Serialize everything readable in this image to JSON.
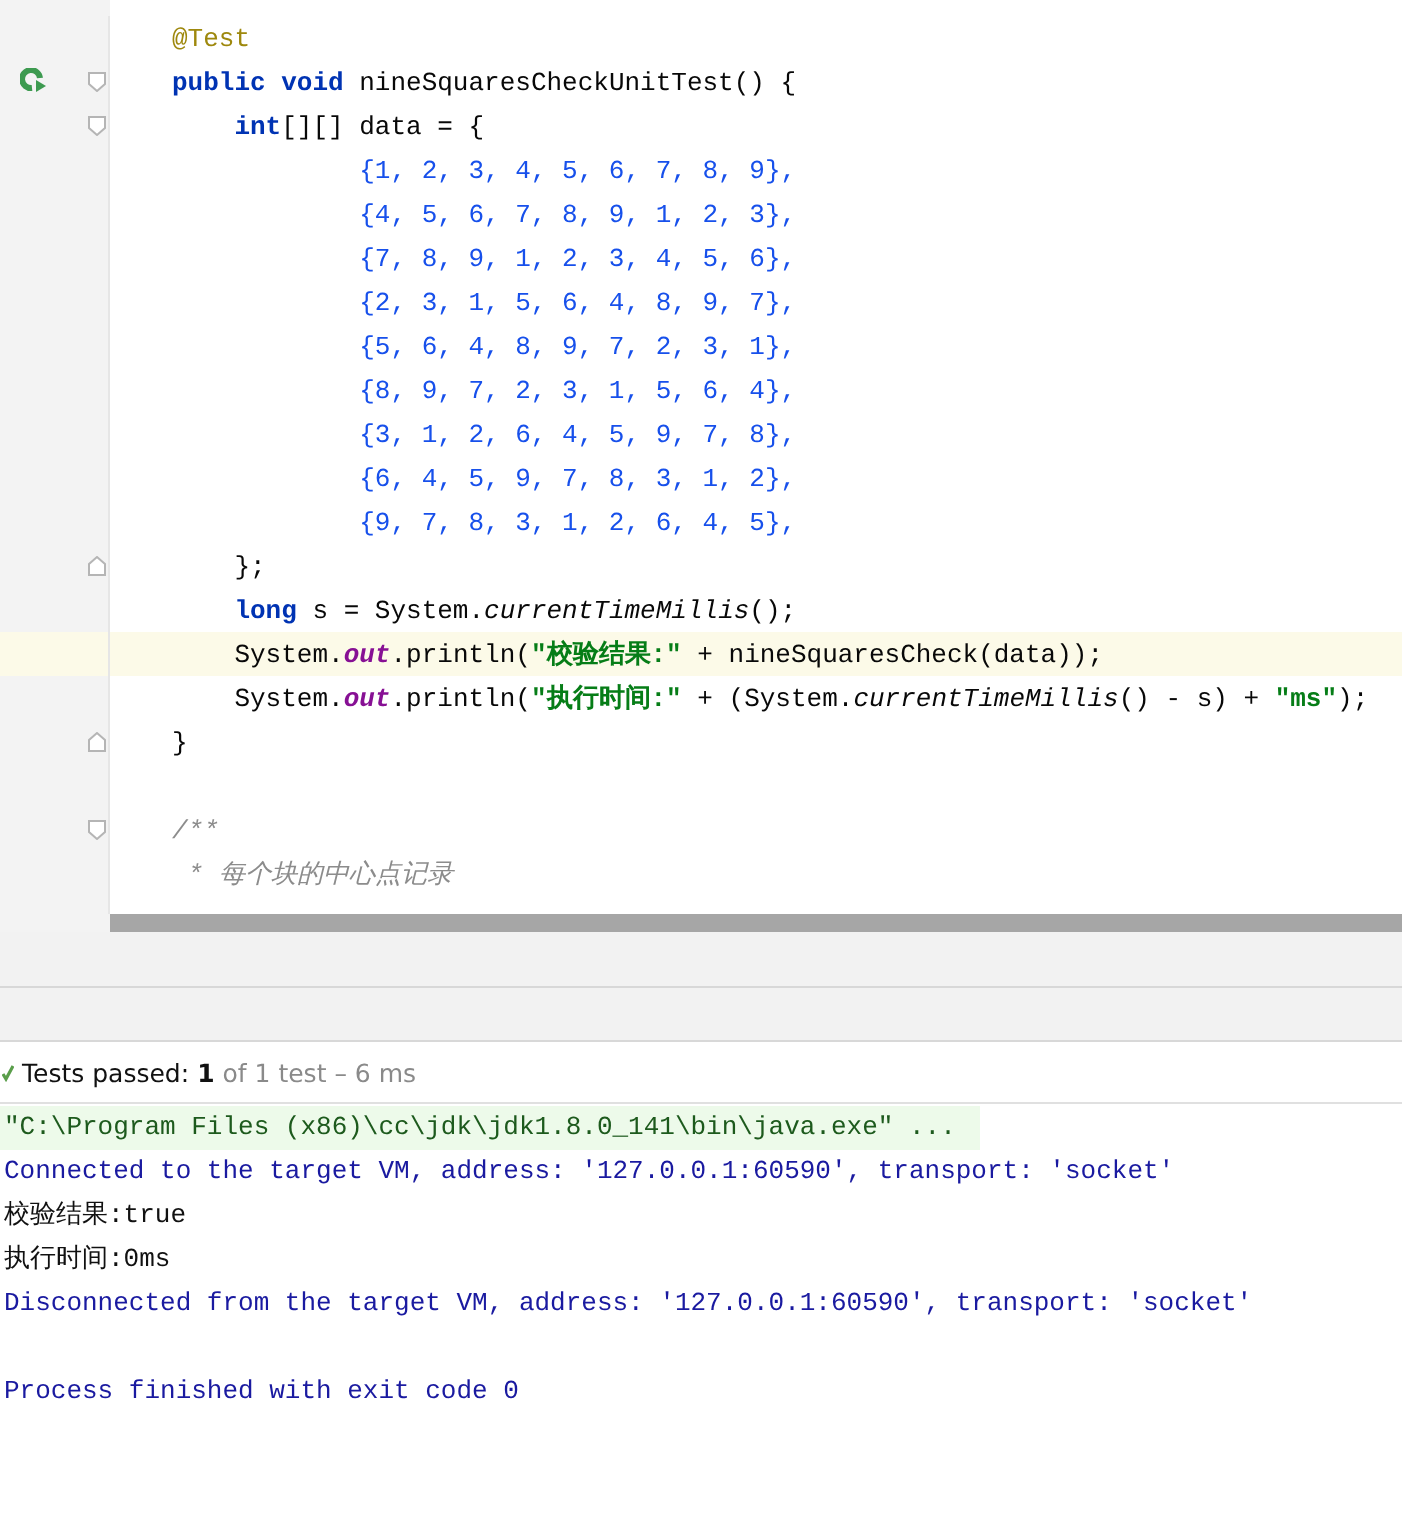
{
  "editor": {
    "lines": [
      {
        "highlighted": false,
        "runnable": false,
        "fold_open": false,
        "fold_close": false,
        "tokens": [
          {
            "text": "@Test",
            "kind": "annotation"
          }
        ]
      },
      {
        "highlighted": false,
        "runnable": true,
        "fold_open": true,
        "fold_close": false,
        "tokens": [
          {
            "text": "public void",
            "kind": "keyword"
          },
          {
            "text": " nineSquaresCheckUnitTest() {",
            "kind": "plain"
          }
        ]
      },
      {
        "highlighted": false,
        "runnable": false,
        "fold_open": true,
        "fold_close": false,
        "tokens": [
          {
            "text": "    int",
            "kind": "keyword"
          },
          {
            "text": "[][] data = {",
            "kind": "plain"
          }
        ]
      },
      {
        "highlighted": false,
        "runnable": false,
        "fold_open": false,
        "fold_close": false,
        "tokens": [
          {
            "text": "            {1, 2, 3, 4, 5, 6, 7, 8, 9},",
            "kind": "number"
          }
        ]
      },
      {
        "highlighted": false,
        "runnable": false,
        "fold_open": false,
        "fold_close": false,
        "tokens": [
          {
            "text": "            {4, 5, 6, 7, 8, 9, 1, 2, 3},",
            "kind": "number"
          }
        ]
      },
      {
        "highlighted": false,
        "runnable": false,
        "fold_open": false,
        "fold_close": false,
        "tokens": [
          {
            "text": "            {7, 8, 9, 1, 2, 3, 4, 5, 6},",
            "kind": "number"
          }
        ]
      },
      {
        "highlighted": false,
        "runnable": false,
        "fold_open": false,
        "fold_close": false,
        "tokens": [
          {
            "text": "            {2, 3, 1, 5, 6, 4, 8, 9, 7},",
            "kind": "number"
          }
        ]
      },
      {
        "highlighted": false,
        "runnable": false,
        "fold_open": false,
        "fold_close": false,
        "tokens": [
          {
            "text": "            {5, 6, 4, 8, 9, 7, 2, 3, 1},",
            "kind": "number"
          }
        ]
      },
      {
        "highlighted": false,
        "runnable": false,
        "fold_open": false,
        "fold_close": false,
        "tokens": [
          {
            "text": "            {8, 9, 7, 2, 3, 1, 5, 6, 4},",
            "kind": "number"
          }
        ]
      },
      {
        "highlighted": false,
        "runnable": false,
        "fold_open": false,
        "fold_close": false,
        "tokens": [
          {
            "text": "            {3, 1, 2, 6, 4, 5, 9, 7, 8},",
            "kind": "number"
          }
        ]
      },
      {
        "highlighted": false,
        "runnable": false,
        "fold_open": false,
        "fold_close": false,
        "tokens": [
          {
            "text": "            {6, 4, 5, 9, 7, 8, 3, 1, 2},",
            "kind": "number"
          }
        ]
      },
      {
        "highlighted": false,
        "runnable": false,
        "fold_open": false,
        "fold_close": false,
        "tokens": [
          {
            "text": "            {9, 7, 8, 3, 1, 2, 6, 4, 5},",
            "kind": "number"
          }
        ]
      },
      {
        "highlighted": false,
        "runnable": false,
        "fold_open": false,
        "fold_close": true,
        "tokens": [
          {
            "text": "    };",
            "kind": "plain"
          }
        ]
      },
      {
        "highlighted": false,
        "runnable": false,
        "fold_open": false,
        "fold_close": false,
        "tokens": [
          {
            "text": "    long",
            "kind": "keyword"
          },
          {
            "text": " s = System.",
            "kind": "plain"
          },
          {
            "text": "currentTimeMillis",
            "kind": "italic"
          },
          {
            "text": "();",
            "kind": "plain"
          }
        ]
      },
      {
        "highlighted": true,
        "runnable": false,
        "fold_open": false,
        "fold_close": false,
        "tokens": [
          {
            "text": "    System.",
            "kind": "plain"
          },
          {
            "text": "out",
            "kind": "field"
          },
          {
            "text": ".println(",
            "kind": "plain"
          },
          {
            "text": "\"校验结果:\"",
            "kind": "string"
          },
          {
            "text": " + nineSquaresCheck(data));",
            "kind": "plain"
          }
        ]
      },
      {
        "highlighted": false,
        "runnable": false,
        "fold_open": false,
        "fold_close": false,
        "tokens": [
          {
            "text": "    System.",
            "kind": "plain"
          },
          {
            "text": "out",
            "kind": "field"
          },
          {
            "text": ".println(",
            "kind": "plain"
          },
          {
            "text": "\"执行时间:\"",
            "kind": "string"
          },
          {
            "text": " + (System.",
            "kind": "plain"
          },
          {
            "text": "currentTimeMillis",
            "kind": "italic"
          },
          {
            "text": "() - s) + ",
            "kind": "plain"
          },
          {
            "text": "\"ms\"",
            "kind": "string"
          },
          {
            "text": ");",
            "kind": "plain"
          }
        ]
      },
      {
        "highlighted": false,
        "runnable": false,
        "fold_open": false,
        "fold_close": true,
        "tokens": [
          {
            "text": "}",
            "kind": "plain"
          }
        ]
      },
      {
        "highlighted": false,
        "runnable": false,
        "fold_open": false,
        "fold_close": false
      },
      {
        "highlighted": false,
        "runnable": false,
        "fold_open": true,
        "fold_close": false,
        "tokens": [
          {
            "text": "/**",
            "kind": "comment"
          }
        ]
      },
      {
        "highlighted": false,
        "runnable": false,
        "fold_open": false,
        "fold_close": false,
        "tokens": [
          {
            "text": " * 每个块的中心点记录",
            "kind": "comment"
          }
        ]
      }
    ]
  },
  "test_status": {
    "passed": true,
    "label": "Tests passed:",
    "count": "1",
    "detail": "of 1 test – 6 ms"
  },
  "console": {
    "lines": [
      {
        "kind": "command",
        "text": "\"C:\\Program Files (x86)\\cc\\jdk\\jdk1.8.0_141\\bin\\java.exe\" ..."
      },
      {
        "kind": "system",
        "text": "Connected to the target VM, address: '127.0.0.1:60590', transport: 'socket'"
      },
      {
        "kind": "output",
        "text": "校验结果:true"
      },
      {
        "kind": "output",
        "text": "执行时间:0ms"
      },
      {
        "kind": "system",
        "text": "Disconnected from the target VM, address: '127.0.0.1:60590', transport: 'socket'"
      },
      {
        "kind": "exit",
        "text": "Process finished with exit code 0"
      }
    ]
  }
}
